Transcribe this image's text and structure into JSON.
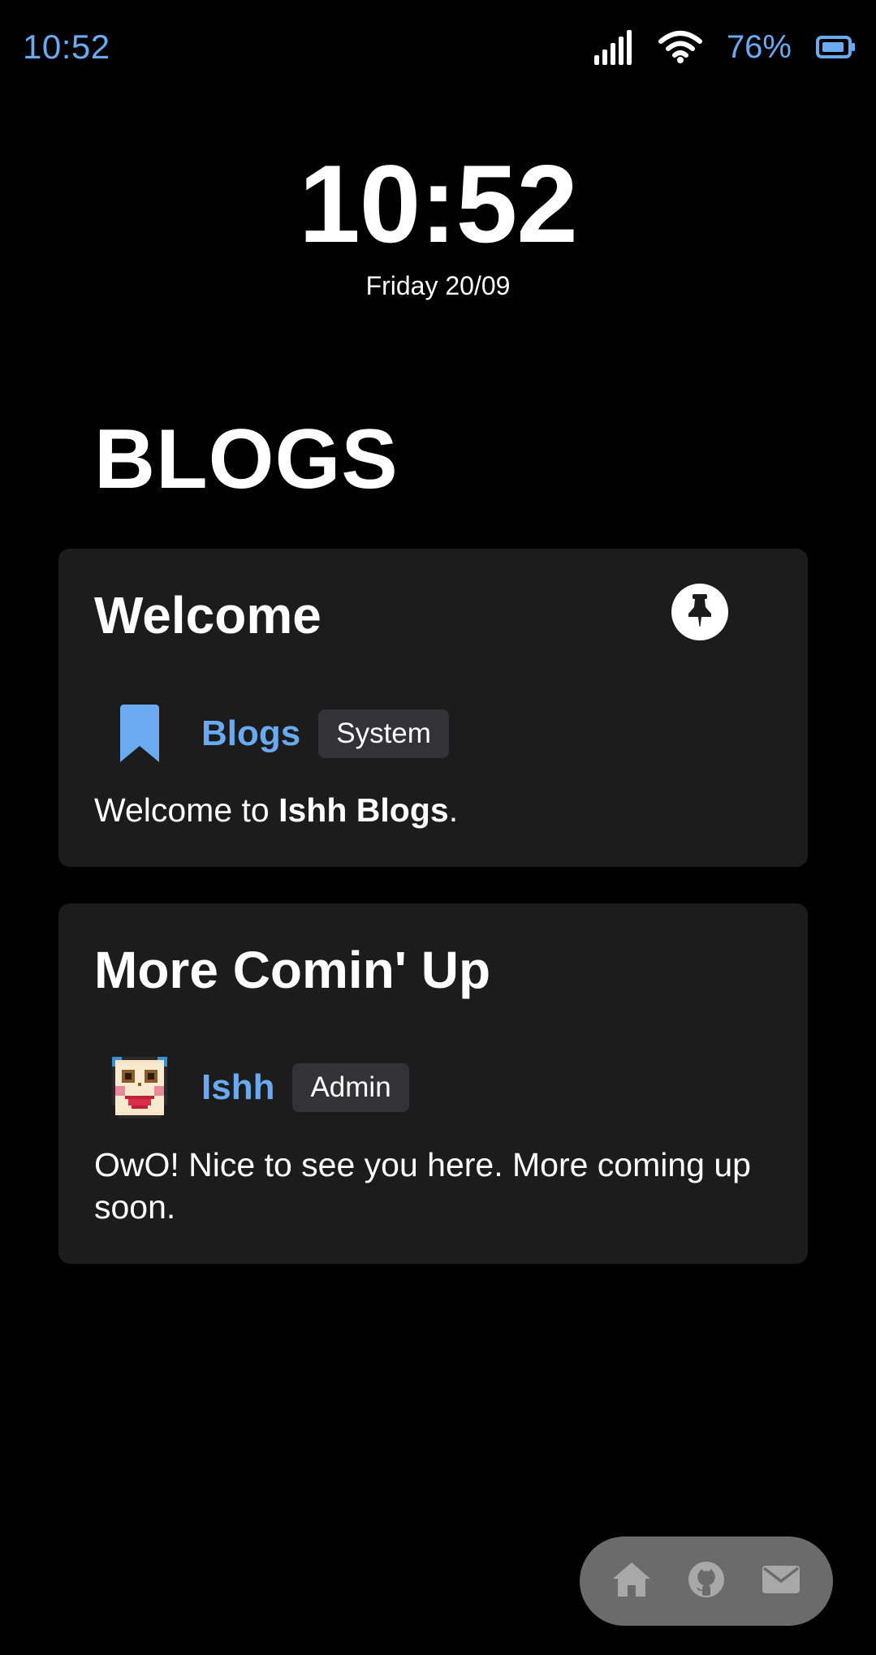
{
  "status_bar": {
    "time": "10:52",
    "battery_percent": "76%",
    "accent_color": "#6aaaf0"
  },
  "lock_clock": {
    "time": "10:52",
    "date": "Friday 20/09"
  },
  "page": {
    "title": "BLOGS"
  },
  "posts": [
    {
      "title": "Welcome",
      "pinned": true,
      "pin_icon": "pin-icon",
      "author": "Blogs",
      "author_icon": "bookmark-icon",
      "role": "System",
      "body_prefix": "Welcome to ",
      "body_bold": "Ishh Blogs",
      "body_suffix": "."
    },
    {
      "title": "More Comin' Up",
      "pinned": false,
      "author": "Ishh",
      "author_icon": "clown-face-avatar",
      "role": "Admin",
      "body": "OwO! Nice to see you here. More coming up soon."
    }
  ],
  "bottom_nav": {
    "items": [
      {
        "icon": "home-icon"
      },
      {
        "icon": "github-icon"
      },
      {
        "icon": "mail-icon"
      }
    ]
  },
  "colors": {
    "background": "#000000",
    "card": "#1c1c1d",
    "badge": "#333336",
    "nav": "#6b6b6b",
    "link": "#6aaaf0"
  }
}
